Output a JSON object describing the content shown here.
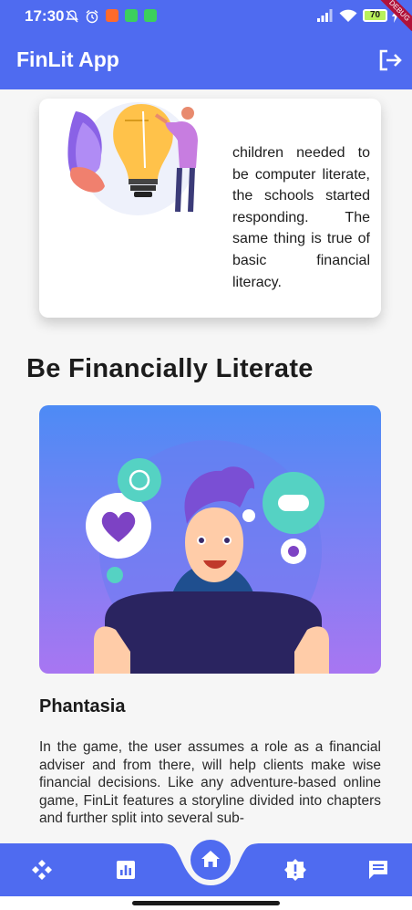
{
  "status_bar": {
    "time": "17:30",
    "battery_level": "70",
    "debug_label": "DEBUG",
    "icons": [
      "mute-icon",
      "alarm-icon",
      "app-badge-icon",
      "wifi-icon",
      "signal-icon",
      "charging-icon"
    ]
  },
  "app_bar": {
    "title": "FinLit App",
    "logout_icon": "logout-icon"
  },
  "intro_card": {
    "text": "children needed to be computer literate, the schools started responding. The same thing is true of basic financial literacy."
  },
  "section": {
    "heading": "Be Financially Literate"
  },
  "game": {
    "title": "Phantasia",
    "description": "In the game, the user assumes a role as a financial adviser and from there, will help clients make wise financial decisions. Like any adventure-based online game, FinLit features a storyline divided into chapters and further split into several sub-"
  },
  "bottom_nav": {
    "items": [
      "gamepad-icon",
      "chart-icon",
      "home-icon",
      "alert-icon",
      "chat-icon"
    ],
    "active": "home-icon"
  },
  "colors": {
    "primary": "#4f6bf0",
    "background": "#f6f6f6",
    "card": "#ffffff"
  }
}
